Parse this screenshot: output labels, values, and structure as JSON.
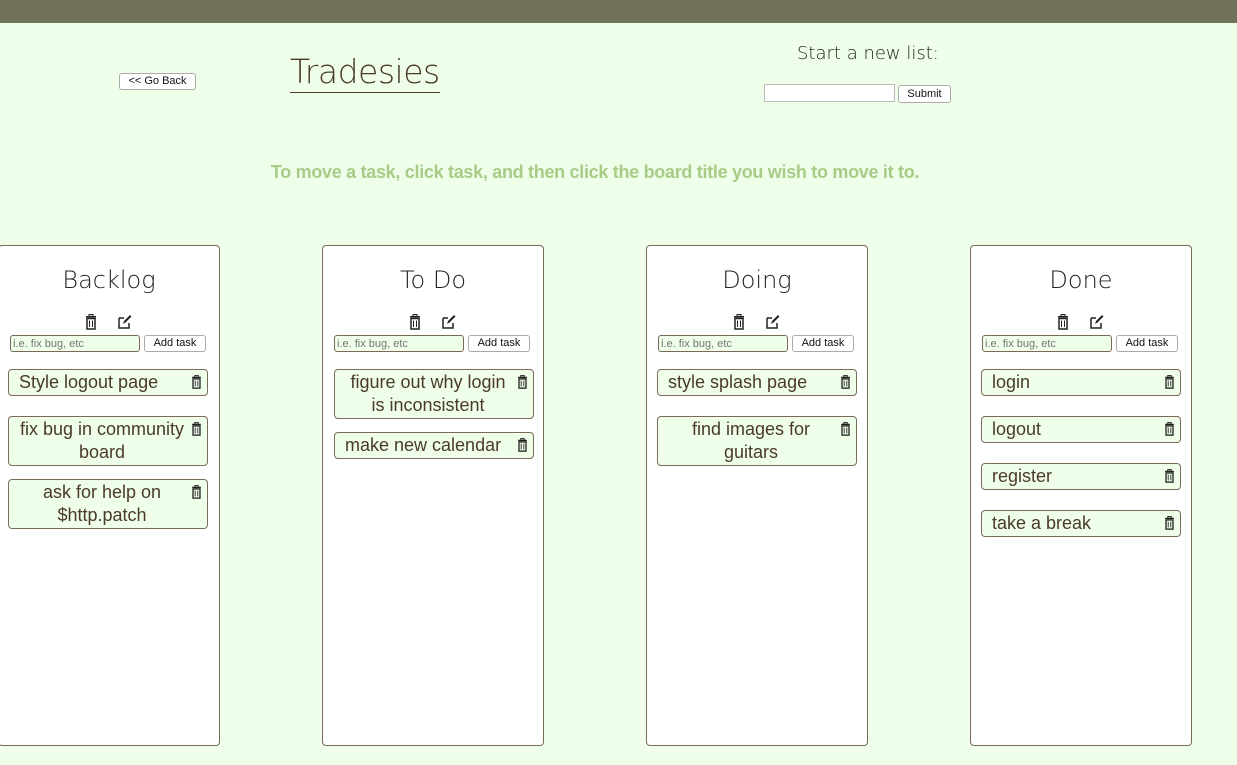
{
  "header": {
    "back_label": "<< Go Back",
    "title": "Tradesies",
    "new_list_label": "Start a new list:",
    "new_list_value": "",
    "submit_label": "Submit"
  },
  "instruction": "To move a task, click task, and then click the board title you wish to move it to.",
  "boards": [
    {
      "title": "Backlog",
      "input_placeholder": "i.e. fix bug, etc",
      "add_label": "Add task",
      "tasks": [
        "Style logout page",
        "fix bug in community board",
        "ask for help on $http.patch"
      ]
    },
    {
      "title": "To Do",
      "input_placeholder": "i.e. fix bug, etc",
      "add_label": "Add task",
      "tasks": [
        "figure out why login is inconsistent",
        "make new calendar"
      ]
    },
    {
      "title": "Doing",
      "input_placeholder": "i.e. fix bug, etc",
      "add_label": "Add task",
      "tasks": [
        "style splash page",
        "find images for guitars"
      ]
    },
    {
      "title": "Done",
      "input_placeholder": "i.e. fix bug, etc",
      "add_label": "Add task",
      "tasks": [
        "login",
        "logout",
        "register",
        "take a break"
      ]
    }
  ],
  "icons": {
    "trash": "trash-icon",
    "edit": "edit-icon"
  },
  "colors": {
    "background": "#effee9",
    "topbar": "#71715a",
    "instruction": "#a6cc87",
    "text": "#4a3a2a"
  }
}
